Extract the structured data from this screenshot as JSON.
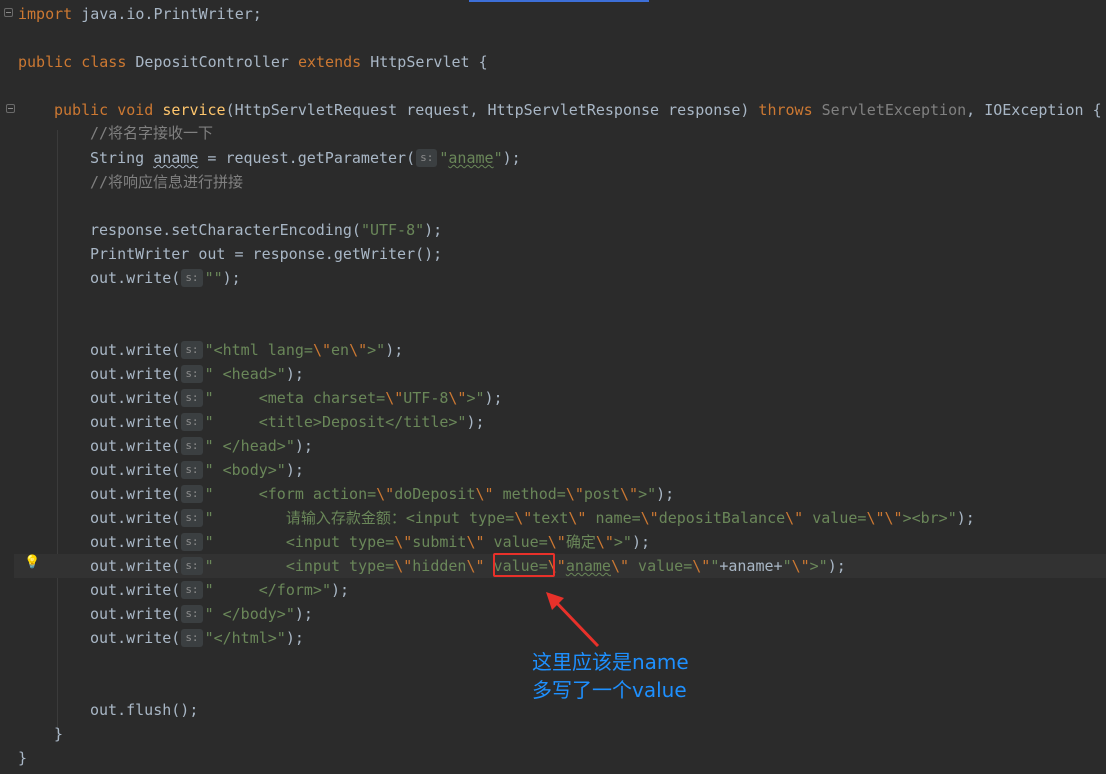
{
  "editor": {
    "language": "Java",
    "lines": {
      "l1": {
        "kw": "import",
        "rest": " java.io.PrintWriter;"
      },
      "l3": {
        "kw1": "public",
        "kw2": "class",
        "cls": " DepositController ",
        "kw3": "extends",
        "rest": " HttpServlet {"
      },
      "l5": {
        "kw1": "public",
        "kw2": "void",
        "fn": "service",
        "params": "(HttpServletRequest request, HttpServletResponse response) ",
        "kw3": "throws",
        "ex1": " ServletException",
        "ex2": ", IOException {"
      },
      "c1": "//将名字接收一下",
      "l7": {
        "pre": "String ",
        "var": "aname",
        "mid": " = request.getParameter(",
        "hint": "s:",
        "str": "\"aname\"",
        "end": ");"
      },
      "c2": "//将响应信息进行拼接",
      "l10": {
        "pre": "response.setCharacterEncoding(",
        "str": "\"UTF-8\"",
        "end": ");"
      },
      "l11": "PrintWriter out = response.getWriter();",
      "l12": {
        "pre": "out.write(",
        "hint": "s:",
        "str": "\"\"",
        "end": ");"
      },
      "w1": {
        "a": "\"<html lang=",
        "b": "\\\"",
        "c": "en",
        "d": "\\\"",
        "e": ">\""
      },
      "w2": "\" <head>\"",
      "w3": {
        "a": "\"     <meta charset=",
        "b": "\\\"",
        "c": "UTF-8",
        "d": "\\\"",
        "e": ">\""
      },
      "w4": "\"     <title>Deposit</title>\"",
      "w5": "\" </head>\"",
      "w6": "\" <body>\"",
      "w7": {
        "a": "\"     <form action=",
        "b": "\\\"",
        "c": "doDeposit",
        "d": "\\\"",
        "e": " method=",
        "f": "\\\"",
        "g": "post",
        "h": "\\\"",
        "i": ">\""
      },
      "w8": {
        "a": "\"        请输入存款金额：<input type=",
        "b": "\\\"",
        "c": "text",
        "d": "\\\"",
        "e": " name=",
        "f": "\\\"",
        "g": "depositBalance",
        "h": "\\\"",
        "i": " value=",
        "j": "\\\"\\\"",
        "k": "><br>\""
      },
      "w9": {
        "a": "\"        <input type=",
        "b": "\\\"",
        "c": "submit",
        "d": "\\\"",
        "e": " value=",
        "f": "\\\"",
        "g": "确定",
        "h": "\\\"",
        "i": ">\""
      },
      "w10": {
        "a": "\"        <input type=",
        "b": "\\\"",
        "c": "hidden",
        "d": "\\\"",
        "e": " value=",
        "f": "\\\"",
        "g": "aname",
        "h": "\\\"",
        "i": " value=",
        "j": "\\\"",
        "k": "\"",
        "plus1": "+aname+",
        "m": "\"",
        "n": "\\\"",
        "o": ">\""
      },
      "w11": "\"     </form>\"",
      "w12": "\" </body>\"",
      "w13": "\"</html>\"",
      "flush": "out.flush();",
      "close1": "}",
      "close2": "}",
      "outw": "out.write(",
      "hint": "s:",
      "end": ");"
    }
  },
  "annotation": {
    "line1": "这里应该是name",
    "line2": "多写了一个value",
    "color": "#1e90ff",
    "box_color": "#e8312a"
  }
}
